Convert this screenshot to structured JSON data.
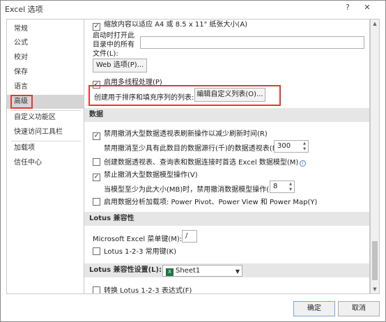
{
  "window": {
    "title": "Excel 选项",
    "help_label": "?",
    "close_label": "✕"
  },
  "sidebar": {
    "items": [
      {
        "label": "常规"
      },
      {
        "label": "公式"
      },
      {
        "label": "校对"
      },
      {
        "label": "保存"
      },
      {
        "label": "语言"
      },
      {
        "label": "高级"
      },
      {
        "label": "自定义功能区"
      },
      {
        "label": "快速访问工具栏"
      },
      {
        "label": "加载项"
      },
      {
        "label": "信任中心"
      }
    ],
    "selected": "高级"
  },
  "content": {
    "row_scale_a4": "缩放内容以适应 A4 或 8.5 x 11\" 纸张大小(A)",
    "row_startup_line1": "启动时打开此",
    "row_startup_line2": "目录中的所有",
    "row_startup_line3": "文件(L):",
    "web_options_button": "Web 选项(P)...",
    "multithread": "启用多线程处理(P)",
    "custom_list_label": "创建用于排序和填充序列的列表:",
    "custom_list_button": "编辑自定义列表(O)...",
    "data_header": "数据",
    "disable_undo_pivot": "禁用撤消大型数据透视表刷新操作以减少刷新时间(R)",
    "disable_undo_pivot_rows_label": "禁用撤消至少具有此数目的数据源行(千)的数据透视表(N):",
    "disable_undo_pivot_rows_value": "300",
    "prefer_data_model": "创建数据透视表、查询表和数据连接时首选 Excel 数据模型(M)",
    "info_glyph": "i",
    "disable_undo_model": "禁止撤消大型数据模型操作(V)",
    "disable_undo_model_label": "当模型至少为此大小(MB)时，禁用撤消数据模型操作(L):",
    "disable_undo_model_value": "8",
    "enable_addins": "启用数据分析加载项: Power Pivot、Power View 和 Power Map(Y)",
    "lotus_header": "Lotus 兼容性",
    "menu_key_label": "Microsoft Excel 菜单键(M):",
    "menu_key_value": "/",
    "lotus_nav_keys": "Lotus 1-2-3 常用键(K)",
    "lotus_settings_label": "Lotus 兼容性设置(L):",
    "lotus_sheet_value": "Sheet1",
    "transition_formula": "转换 Lotus 1-2-3 表达式(F)"
  },
  "checkbox_states": {
    "scale_a4": true,
    "multithread": true,
    "disable_undo_pivot": true,
    "prefer_data_model": false,
    "disable_undo_model": true,
    "enable_addins": false,
    "lotus_nav_keys": false,
    "transition_formula": false
  },
  "footer": {
    "ok": "确定",
    "cancel": "取消"
  },
  "colors": {
    "highlight": "#e33333",
    "selected_bg": "#d5d5d5",
    "section_bg": "#e6e6e6"
  }
}
